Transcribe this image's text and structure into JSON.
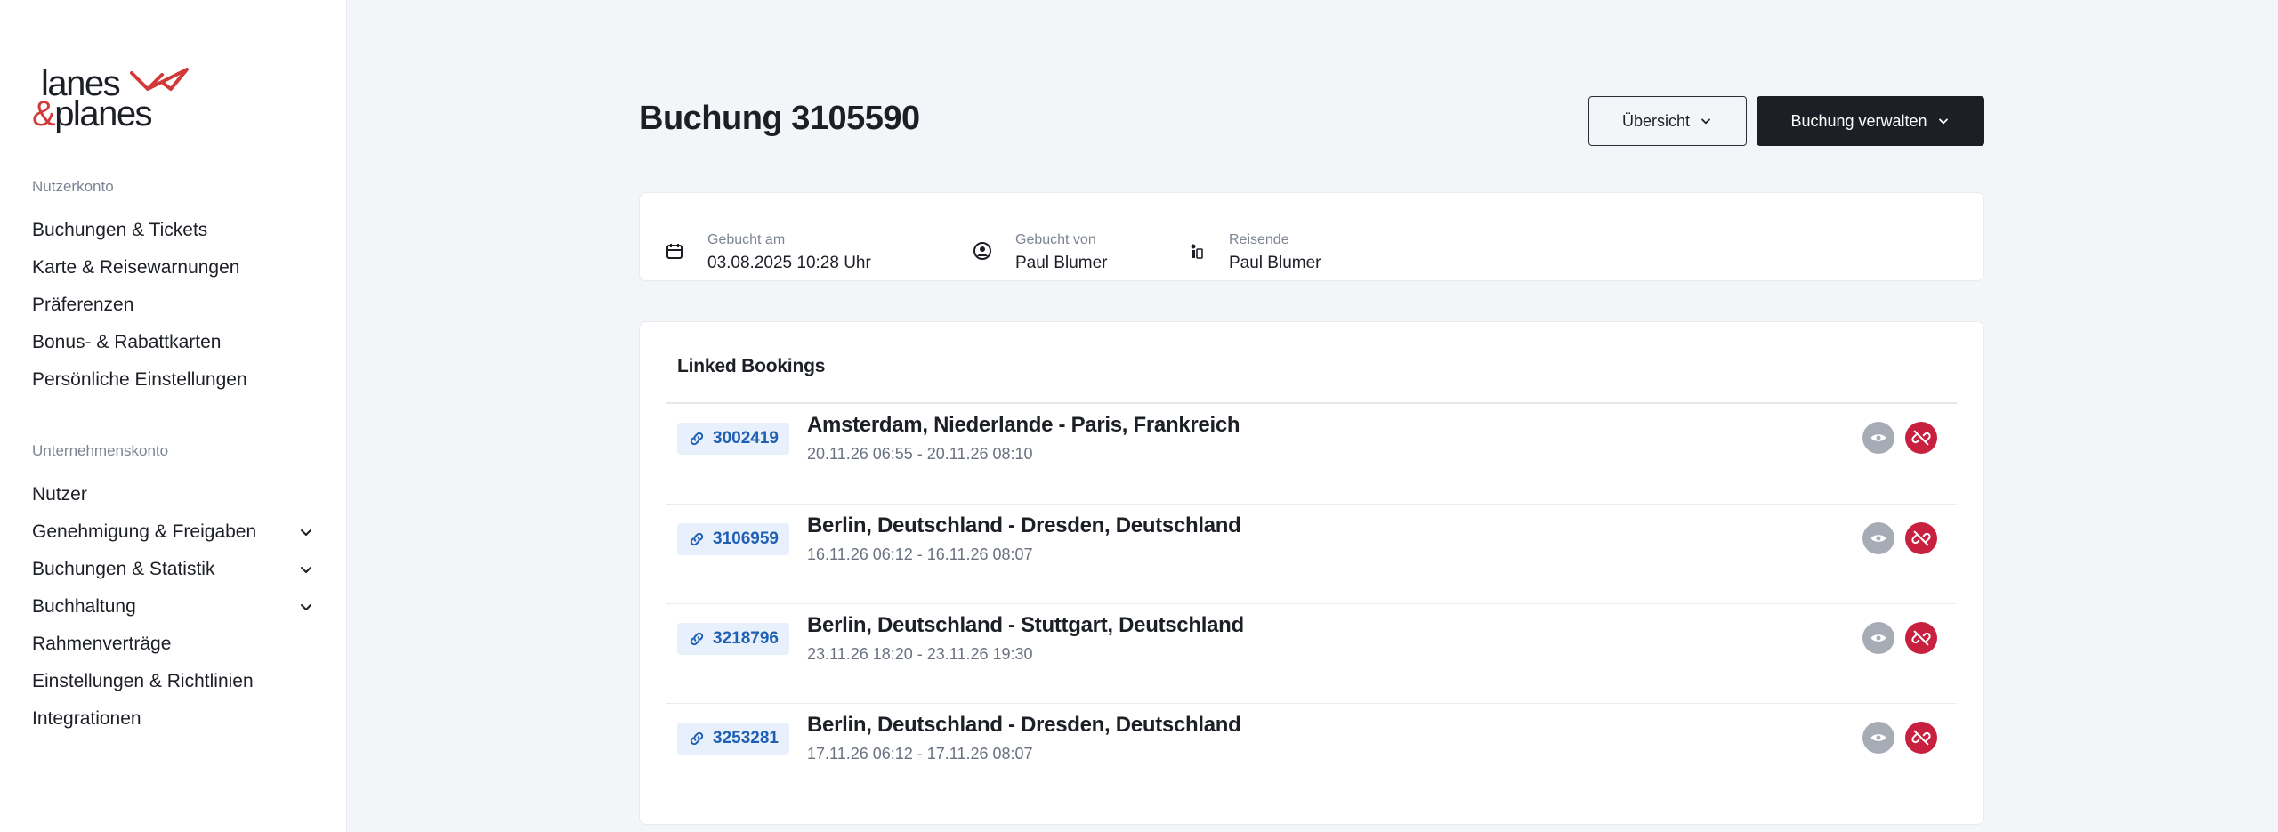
{
  "brand": {
    "logo_line1": "lanes",
    "logo_amp": "&",
    "logo_line2": "planes",
    "accent_color": "#d23a3a"
  },
  "sidebar": {
    "user_heading": "Nutzerkonto",
    "user_items": [
      {
        "label": "Buchungen & Tickets"
      },
      {
        "label": "Karte & Reisewarnungen"
      },
      {
        "label": "Präferenzen"
      },
      {
        "label": "Bonus- & Rabattkarten"
      },
      {
        "label": "Persönliche Einstellungen"
      }
    ],
    "company_heading": "Unternehmenskonto",
    "company_items": [
      {
        "label": "Nutzer",
        "expandable": false
      },
      {
        "label": "Genehmigung & Freigaben",
        "expandable": true
      },
      {
        "label": "Buchungen & Statistik",
        "expandable": true
      },
      {
        "label": "Buchhaltung",
        "expandable": true
      },
      {
        "label": "Rahmenverträge",
        "expandable": false
      },
      {
        "label": "Einstellungen & Richtlinien",
        "expandable": false
      },
      {
        "label": "Integrationen",
        "expandable": false
      }
    ]
  },
  "header": {
    "title": "Buchung 3105590",
    "overview_button": "Übersicht",
    "manage_button": "Buchung verwalten"
  },
  "info": {
    "items": [
      {
        "icon": "calendar-icon",
        "label": "Gebucht am",
        "value": "03.08.2025 10:28 Uhr"
      },
      {
        "icon": "user-icon",
        "label": "Gebucht von",
        "value": "Paul Blumer"
      },
      {
        "icon": "traveller-icon",
        "label": "Reisende",
        "value": "Paul Blumer"
      }
    ]
  },
  "linked": {
    "title": "Linked Bookings",
    "rows": [
      {
        "id": "3002419",
        "route": "Amsterdam, Niederlande - Paris, Frankreich",
        "times": "20.11.26 06:55 - 20.11.26 08:10"
      },
      {
        "id": "3106959",
        "route": "Berlin, Deutschland - Dresden, Deutschland",
        "times": "16.11.26 06:12 - 16.11.26 08:07"
      },
      {
        "id": "3218796",
        "route": "Berlin, Deutschland - Stuttgart, Deutschland",
        "times": "23.11.26 18:20 - 23.11.26 19:30"
      },
      {
        "id": "3253281",
        "route": "Berlin, Deutschland - Dresden, Deutschland",
        "times": "17.11.26 06:12 - 17.11.26 08:07"
      }
    ],
    "view_color": "#a6abb6",
    "unlink_color": "#c8213f",
    "chip_color": "#1f5fb4"
  }
}
